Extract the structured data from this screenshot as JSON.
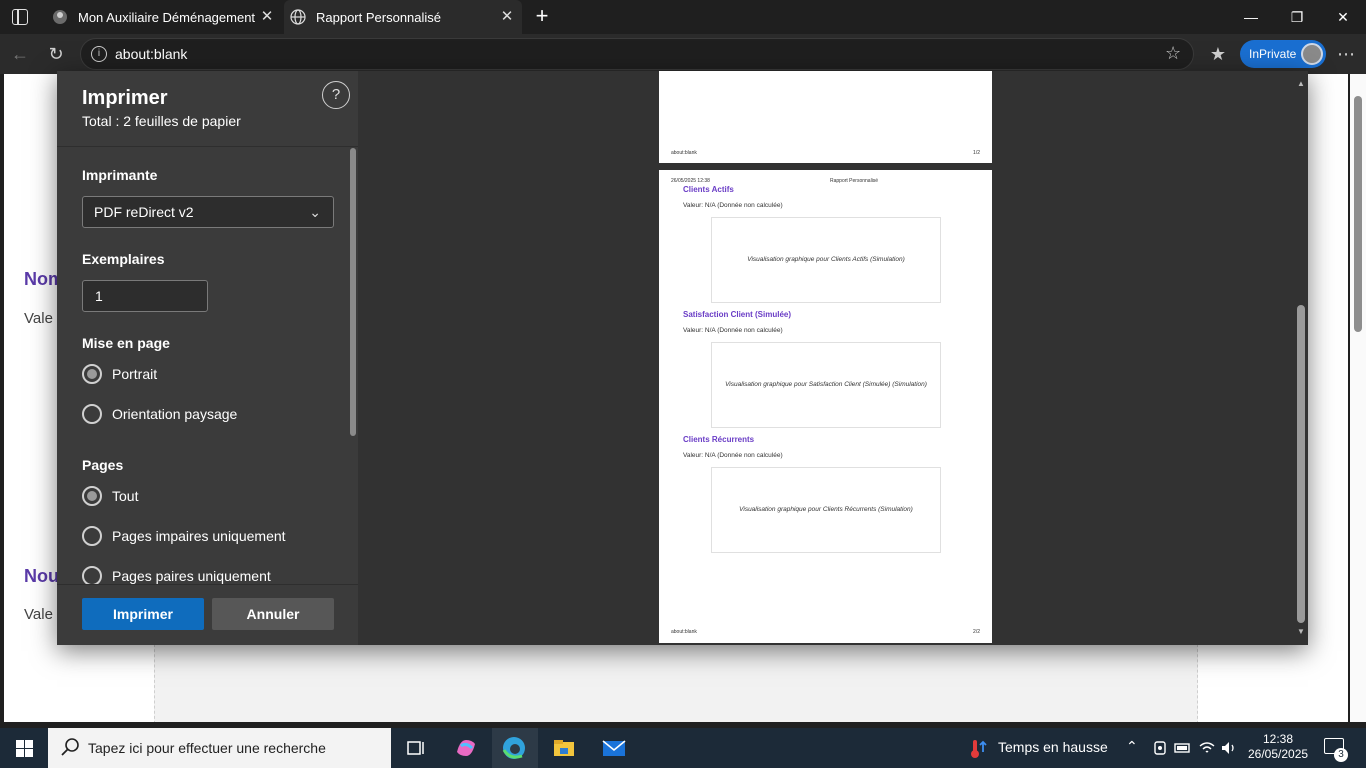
{
  "tabs": [
    {
      "label": "Mon Auxiliaire Déménagement",
      "close": "✕"
    },
    {
      "label": "Rapport Personnalisé",
      "close": "✕"
    }
  ],
  "address": {
    "url": "about:blank"
  },
  "inprivate_label": "InPrivate",
  "background_page": {
    "title1": "Nom",
    "text1": "Vale",
    "title2": "Nou",
    "text2": "Vale"
  },
  "print_dialog": {
    "title": "Imprimer",
    "subtitle": "Total : 2 feuilles de papier",
    "help": "?",
    "printer_label": "Imprimante",
    "printer_value": "PDF reDirect v2",
    "copies_label": "Exemplaires",
    "copies_value": "1",
    "layout_label": "Mise en page",
    "layout_options": [
      {
        "label": "Portrait",
        "selected": true
      },
      {
        "label": "Orientation paysage",
        "selected": false
      }
    ],
    "pages_label": "Pages",
    "pages_options": [
      {
        "label": "Tout",
        "selected": true
      },
      {
        "label": "Pages impaires uniquement",
        "selected": false
      },
      {
        "label": "Pages paires uniquement",
        "selected": false
      }
    ],
    "print_button": "Imprimer",
    "cancel_button": "Annuler"
  },
  "preview": {
    "page1": {
      "footer_left": "about:blank",
      "footer_right": "1/2"
    },
    "page2": {
      "header_left": "26/05/2025 12:38",
      "header_center": "Rapport Personnalisé",
      "footer_left": "about:blank",
      "footer_right": "2/2",
      "sections": [
        {
          "title": "Clients Actifs",
          "value": "Valeur: N/A (Donnée non calculée)",
          "viz": "Visualisation graphique pour Clients Actifs (Simulation)"
        },
        {
          "title": "Satisfaction Client (Simulée)",
          "value": "Valeur: N/A (Donnée non calculée)",
          "viz": "Visualisation graphique pour Satisfaction Client (Simulée) (Simulation)"
        },
        {
          "title": "Clients Récurrents",
          "value": "Valeur: N/A (Donnée non calculée)",
          "viz": "Visualisation graphique pour Clients Récurrents (Simulation)"
        }
      ]
    }
  },
  "taskbar": {
    "search_placeholder": "Tapez ici pour effectuer une recherche",
    "weather": "Temps en hausse",
    "time": "12:38",
    "date": "26/05/2025",
    "notifications": "3"
  }
}
